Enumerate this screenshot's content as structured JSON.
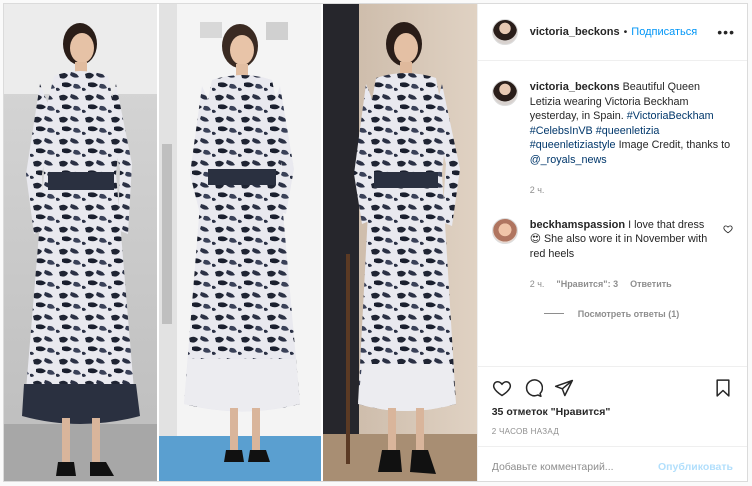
{
  "post": {
    "username": "victoria_beckons",
    "follow_label": "Подписаться",
    "more_label": "•••"
  },
  "caption": {
    "username": "victoria_beckons",
    "text_before": "Beautiful Queen Letizia wearing Victoria Beckham yesterday, in Spain.",
    "hashtags": "#VictoriaBeckham #CelebsInVB #queenletizia #queenletiziastyle",
    "text_after": "Image Credit, thanks to",
    "mention": "@_royals_news",
    "time": "2 ч."
  },
  "comment": {
    "username": "beckhamspassion",
    "text": "I love that dress 😍 She also wore it in November with red heels",
    "time": "2 ч.",
    "likes": "\"Нравится\": 3",
    "reply_label": "Ответить",
    "view_replies": "Посмотреть ответы (1)"
  },
  "actions": {
    "likes_text": "35 отметок \"Нравится\"",
    "posted_ago": "2 ЧАСОВ НАЗАД"
  },
  "composer": {
    "placeholder": "Добавьте комментарий...",
    "post_label": "Опубликовать"
  },
  "colors": {
    "accent": "#0095f6",
    "link": "#00376b",
    "muted": "#8e8e8e",
    "post_disabled": "#b2dffc"
  },
  "icons": [
    "heart-icon",
    "comment-icon",
    "share-icon",
    "bookmark-icon",
    "more-icon"
  ]
}
